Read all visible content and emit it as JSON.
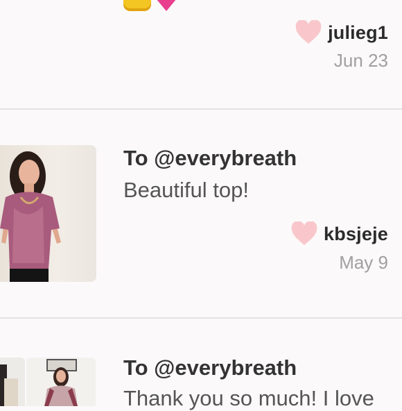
{
  "comments": [
    {
      "liker": "julieg1",
      "date": "Jun 23",
      "emojis": [
        "thumbs-up-emoji",
        "pink-heart-emoji"
      ]
    },
    {
      "to": "To @everybreath",
      "message": "Beautiful top!",
      "liker": "kbsjeje",
      "date": "May 9"
    },
    {
      "to": "To @everybreath",
      "message": "Thank you so much! I love"
    }
  ],
  "colors": {
    "background": "#fbf9fa",
    "like_heart": "#f9c7cb",
    "divider": "#e4e2e3",
    "username": "#2b2b2b",
    "date": "#a0a0a0"
  }
}
